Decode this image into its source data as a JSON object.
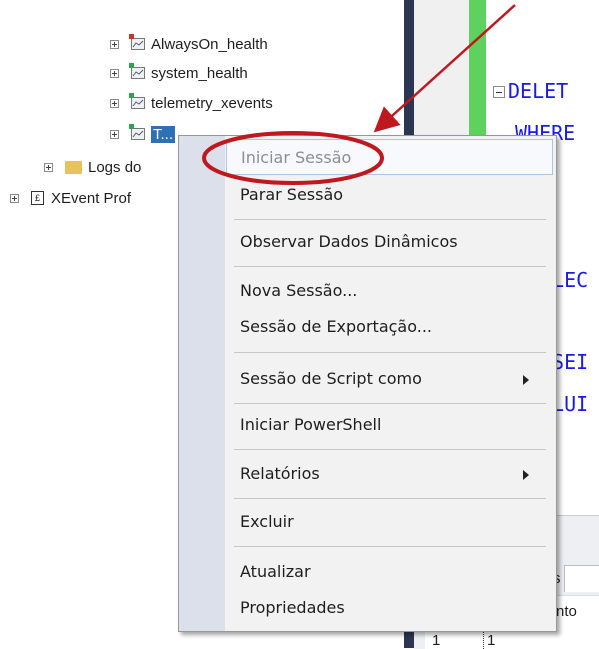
{
  "tree": {
    "items": [
      {
        "label": "AlwaysOn_health",
        "icon": "session-stopped-icon"
      },
      {
        "label": "system_health",
        "icon": "session-running-icon"
      },
      {
        "label": "telemetry_xevents",
        "icon": "session-running-icon"
      },
      {
        "label": "T...",
        "icon": "session-running-icon"
      },
      {
        "label": "Logs do",
        "icon": "folder-icon"
      },
      {
        "label": "XEvent Prof",
        "icon": "xevent-profiler-icon"
      }
    ]
  },
  "editor": {
    "lines": [
      "DELET",
      "WHERE",
      "ELEC",
      "ISEI",
      "ALUI"
    ],
    "results_tab_label": "s",
    "results_header": "nto",
    "row_number": "1",
    "row_value": "1"
  },
  "context_menu": {
    "items": [
      {
        "label": "Iniciar Sessão",
        "enabled": false
      },
      {
        "label": "Parar Sessão",
        "enabled": true
      },
      {
        "label": "Observar Dados Dinâmicos",
        "enabled": true
      },
      {
        "label": "Nova Sessão...",
        "enabled": true
      },
      {
        "label": "Sessão de Exportação...",
        "enabled": true
      },
      {
        "label": "Sessão de Script como",
        "enabled": true,
        "submenu": true
      },
      {
        "label": "Iniciar PowerShell",
        "enabled": true
      },
      {
        "label": "Relatórios",
        "enabled": true,
        "submenu": true
      },
      {
        "label": "Excluir",
        "enabled": true
      },
      {
        "label": "Atualizar",
        "enabled": true
      },
      {
        "label": "Propriedades",
        "enabled": true
      }
    ]
  },
  "colors": {
    "annotation": "#c0181f",
    "code_keyword": "#1a1ae6",
    "menu_gutter": "#dbe0ea",
    "splitter": "#2c3650",
    "change_bar": "#5fd15f"
  }
}
